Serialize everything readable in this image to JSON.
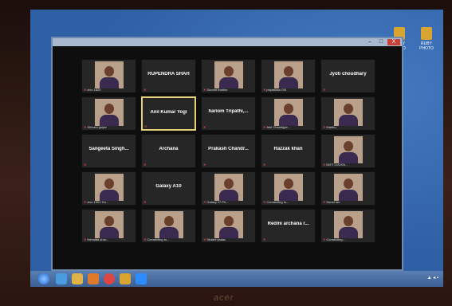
{
  "desktop": {
    "icons": [
      {
        "label": "RUBY VIDEO",
        "icon": "folder-icon"
      },
      {
        "label": "RUBY PHOTO",
        "icon": "folder-icon"
      }
    ]
  },
  "window": {
    "controls": [
      "–",
      "□",
      "X"
    ]
  },
  "participants": [
    {
      "name": "",
      "label": "vivo 1820",
      "video": true
    },
    {
      "name": "RUPENDRA SHAH",
      "label": "",
      "video": false
    },
    {
      "name": "",
      "label": "Sonam mathur",
      "video": true
    },
    {
      "name": "",
      "label": "priyankaa Gill",
      "video": true
    },
    {
      "name": "Jyoti choudhary",
      "label": "",
      "video": false
    },
    {
      "name": "",
      "label": "Shivani gurjar",
      "video": true
    },
    {
      "name": "Anil Kumar Yogi",
      "label": "",
      "video": false,
      "active": true
    },
    {
      "name": "hariom Tripathi,...",
      "label": "",
      "video": false
    },
    {
      "name": "",
      "label": "Atul Chandigar...",
      "video": true
    },
    {
      "name": "",
      "label": "Madhu",
      "video": true
    },
    {
      "name": "Sangeeta Singh...",
      "label": "",
      "video": false
    },
    {
      "name": "Archana",
      "label": "",
      "video": false
    },
    {
      "name": "Prakash Chandr...",
      "label": "",
      "video": false
    },
    {
      "name": "Razzak khan",
      "label": "",
      "video": false
    },
    {
      "name": "",
      "label": "DIET LUCKN...",
      "video": true
    },
    {
      "name": "",
      "label": "vivo 1901 Hu...",
      "video": true
    },
    {
      "name": "Galaxy A10",
      "label": "",
      "video": false
    },
    {
      "name": "",
      "label": "Galaxy J7 Pri...",
      "video": true
    },
    {
      "name": "",
      "label": "Connecting to...",
      "video": true
    },
    {
      "name": "",
      "label": "Sonal rao",
      "video": true
    },
    {
      "name": "",
      "label": "Hemlata shar...",
      "video": true
    },
    {
      "name": "",
      "label": "Connecting to...",
      "video": true
    },
    {
      "name": "",
      "label": "Shalini yadav",
      "video": true
    },
    {
      "name": "Redmi archana r...",
      "label": "",
      "video": false
    },
    {
      "name": "",
      "label": "Connecting...",
      "video": true
    }
  ],
  "taskbar": {
    "apps": [
      "start-orb",
      "ie-icon",
      "explorer-icon",
      "media-icon",
      "chrome-icon",
      "folder-icon",
      "zoom-icon"
    ],
    "tray": "▲ ◂ ▪"
  },
  "brand": "acer"
}
